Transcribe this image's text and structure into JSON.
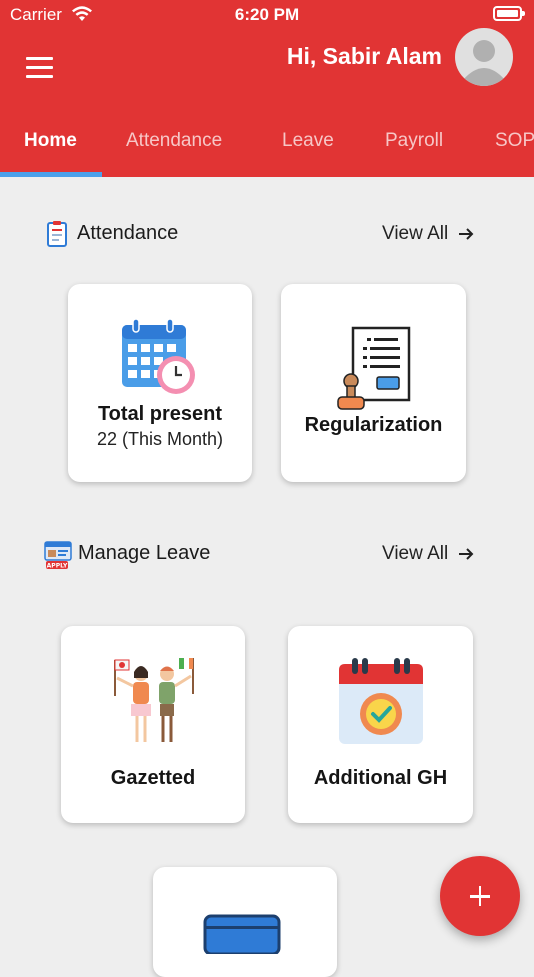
{
  "status": {
    "carrier": "Carrier",
    "time": "6:20 PM"
  },
  "header": {
    "greeting": "Hi, Sabir Alam"
  },
  "tabs": [
    {
      "label": "Home",
      "active": true
    },
    {
      "label": "Attendance"
    },
    {
      "label": "Leave"
    },
    {
      "label": "Payroll"
    },
    {
      "label": "SOP"
    }
  ],
  "attendance": {
    "title": "Attendance",
    "view_all": "View All",
    "cards": [
      {
        "title": "Total present",
        "subtitle": "22  (This Month)",
        "icon": "calendar-clock-icon"
      },
      {
        "title": "Regularization",
        "icon": "document-stamp-icon"
      }
    ]
  },
  "leave": {
    "title": "Manage Leave",
    "view_all": "View All",
    "cards": [
      {
        "title": "Gazetted",
        "icon": "people-flags-icon"
      },
      {
        "title": "Additional GH",
        "icon": "calendar-check-icon"
      },
      {
        "title": "",
        "icon": "book-icon"
      }
    ]
  },
  "colors": {
    "primary": "#e13434",
    "tab_indicator": "#4ba0ea",
    "background": "#eeeeee"
  }
}
